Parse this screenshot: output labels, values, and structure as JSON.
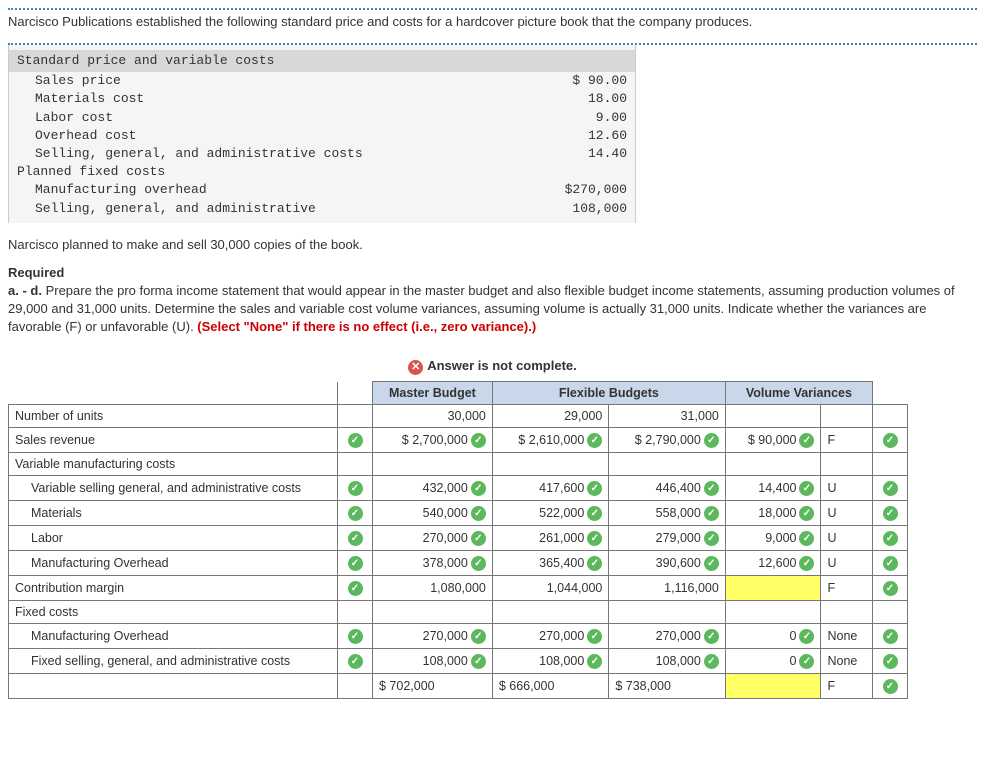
{
  "intro": "Narcisco Publications established the following standard price and costs for a hardcover picture book that the company produces.",
  "cost_table": {
    "header1": "Standard price and variable costs",
    "rows1": [
      {
        "label": "Sales price",
        "value": "$  90.00"
      },
      {
        "label": "Materials cost",
        "value": "18.00"
      },
      {
        "label": "Labor cost",
        "value": "9.00"
      },
      {
        "label": "Overhead cost",
        "value": "12.60"
      },
      {
        "label": "Selling, general, and administrative costs",
        "value": "14.40"
      }
    ],
    "header2": "Planned fixed costs",
    "rows2": [
      {
        "label": "Manufacturing overhead",
        "value": "$270,000"
      },
      {
        "label": "Selling, general, and administrative",
        "value": "108,000"
      }
    ]
  },
  "planned_text": "Narcisco planned to make and sell 30,000 copies of the book.",
  "required": {
    "title": "Required",
    "body_a": "a. - d. ",
    "body_b": "Prepare the pro forma income statement that would appear in the master budget and also flexible budget income statements, assuming production volumes of 29,000 and 31,000 units. Determine the sales and variable cost volume variances, assuming volume is actually 31,000 units. Indicate whether the variances are favorable (F) or unfavorable (U). ",
    "body_red": "(Select \"None\" if there is no effect (i.e., zero variance).)"
  },
  "answer_banner": "Answer is not complete.",
  "headers": {
    "master": "Master Budget",
    "flex": "Flexible Budgets",
    "vol": "Volume Variances"
  },
  "table": {
    "units": {
      "label": "Number of units",
      "master": "30,000",
      "f1": "29,000",
      "f2": "31,000"
    },
    "sales": {
      "label": "Sales revenue",
      "master": "$ 2,700,000",
      "f1": "$ 2,610,000",
      "f2": "$ 2,790,000",
      "vv": "$ 90,000",
      "fu": "F"
    },
    "vmc_header": "Variable manufacturing costs",
    "vsga": {
      "label": "Variable selling general, and administrative costs",
      "master": "432,000",
      "f1": "417,600",
      "f2": "446,400",
      "vv": "14,400",
      "fu": "U"
    },
    "materials": {
      "label": "Materials",
      "master": "540,000",
      "f1": "522,000",
      "f2": "558,000",
      "vv": "18,000",
      "fu": "U"
    },
    "labor": {
      "label": "Labor",
      "master": "270,000",
      "f1": "261,000",
      "f2": "279,000",
      "vv": "9,000",
      "fu": "U"
    },
    "moh": {
      "label": "Manufacturing Overhead",
      "master": "378,000",
      "f1": "365,400",
      "f2": "390,600",
      "vv": "12,600",
      "fu": "U"
    },
    "cm": {
      "label": "Contribution margin",
      "master": "1,080,000",
      "f1": "1,044,000",
      "f2": "1,116,000",
      "vv": "",
      "fu": "F"
    },
    "fc_header": "Fixed costs",
    "fmoh": {
      "label": "Manufacturing Overhead",
      "master": "270,000",
      "f1": "270,000",
      "f2": "270,000",
      "vv": "0",
      "fu": "None"
    },
    "fsga": {
      "label": "Fixed selling, general, and administrative costs",
      "master": "108,000",
      "f1": "108,000",
      "f2": "108,000",
      "vv": "0",
      "fu": "None"
    },
    "total": {
      "master": "$    702,000",
      "f1": "$ 666,000",
      "f2": "$ 738,000",
      "vv": "",
      "fu": "F"
    }
  }
}
